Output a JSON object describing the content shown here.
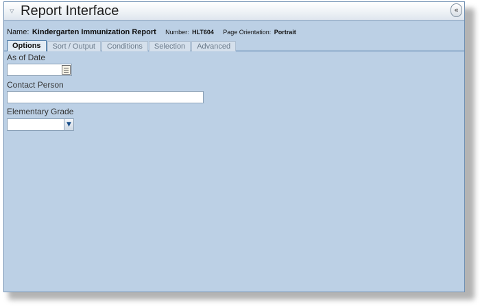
{
  "window": {
    "title": "Report Interface",
    "collapse_glyph": "«"
  },
  "report": {
    "name_label": "Name:",
    "name_value": "Kindergarten Immunization Report",
    "number_label": "Number:",
    "number_value": "HLT604",
    "orientation_label": "Page Orientation:",
    "orientation_value": "Portrait"
  },
  "tabs": [
    {
      "label": "Options",
      "active": true
    },
    {
      "label": "Sort / Output",
      "active": false
    },
    {
      "label": "Conditions",
      "active": false
    },
    {
      "label": "Selection",
      "active": false
    },
    {
      "label": "Advanced",
      "active": false
    }
  ],
  "fields": {
    "as_of_date": {
      "label": "As of Date",
      "value": ""
    },
    "contact_person": {
      "label": "Contact Person",
      "value": ""
    },
    "elementary_grade": {
      "label": "Elementary Grade",
      "selected": ""
    }
  },
  "colors": {
    "panel_bg": "#bcd0e5",
    "tab_border": "#3f6f9f"
  }
}
